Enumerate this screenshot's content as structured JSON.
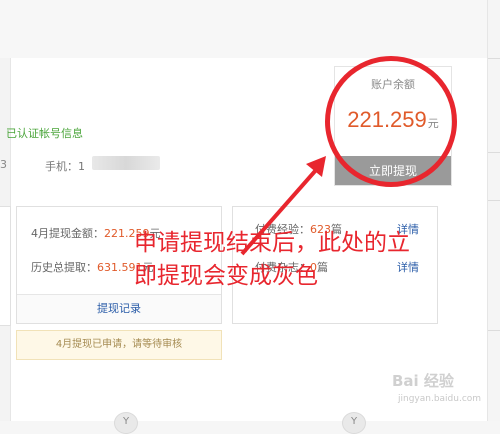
{
  "account": {
    "verified_text": "已认证帐号信息",
    "digit_fragment": "3",
    "phone_label": "手机：1"
  },
  "balance": {
    "label": "账户余额",
    "amount": "221.259",
    "unit": "元",
    "withdraw_button": "立即提现"
  },
  "withdraw_panel": {
    "month_label": "4月提现金额：",
    "month_value": "221.259",
    "month_unit": "元",
    "total_label": "历史总提取：",
    "total_value": "631.591",
    "total_unit": "元",
    "record_link": "提现记录",
    "notice": "4月提现已申请，请等待审核"
  },
  "fee_panel": {
    "row1_label": "付费经验：",
    "row1_value": "623",
    "row1_unit": "篇",
    "row1_detail": "详情",
    "row2_label": "付费杂志：",
    "row2_value": "0",
    "row2_unit": "篇",
    "row2_detail": "详情"
  },
  "annotation": {
    "line1": "申请提现结束后，此处的立",
    "line2": "即提现会变成灰色",
    "color": "#e8262e"
  },
  "bottom_badges": [
    "Y",
    "Y"
  ],
  "watermark": {
    "main": "Bai 经验",
    "sub": "jingyan.baidu.com"
  },
  "colors": {
    "accent": "#e05a2a",
    "verified": "#4aa53a",
    "link": "#2a5ca8",
    "button_disabled": "#9a9a9a"
  }
}
